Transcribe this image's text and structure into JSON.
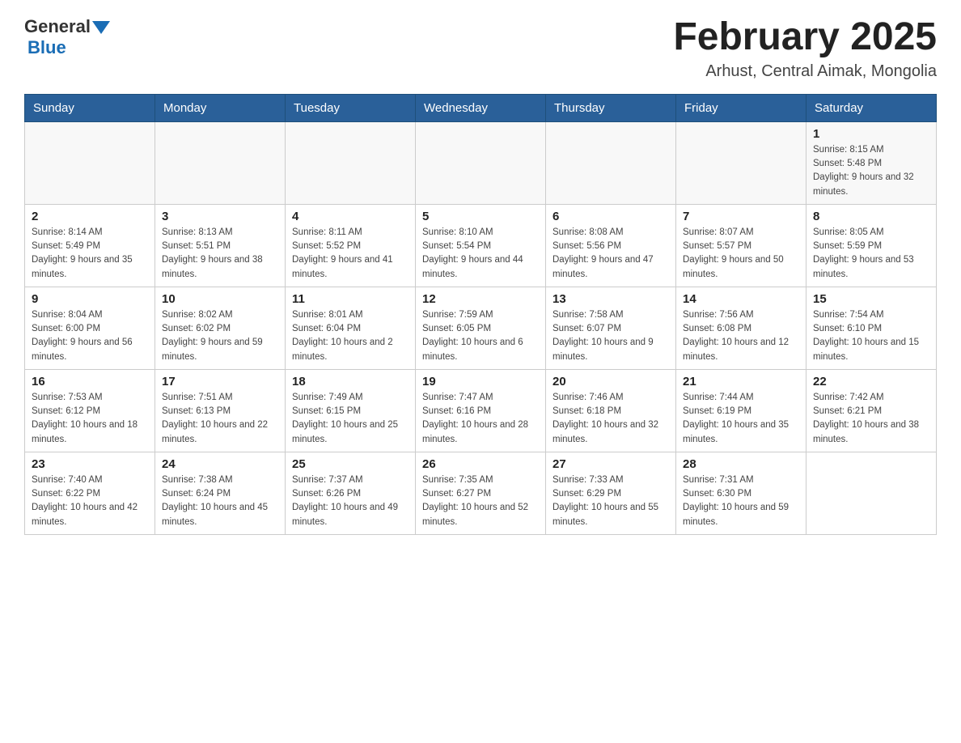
{
  "header": {
    "logo_general": "General",
    "logo_blue": "Blue",
    "title": "February 2025",
    "subtitle": "Arhust, Central Aimak, Mongolia"
  },
  "days_of_week": [
    "Sunday",
    "Monday",
    "Tuesday",
    "Wednesday",
    "Thursday",
    "Friday",
    "Saturday"
  ],
  "weeks": [
    {
      "days": [
        {
          "date": "",
          "info": ""
        },
        {
          "date": "",
          "info": ""
        },
        {
          "date": "",
          "info": ""
        },
        {
          "date": "",
          "info": ""
        },
        {
          "date": "",
          "info": ""
        },
        {
          "date": "",
          "info": ""
        },
        {
          "date": "1",
          "info": "Sunrise: 8:15 AM\nSunset: 5:48 PM\nDaylight: 9 hours and 32 minutes."
        }
      ]
    },
    {
      "days": [
        {
          "date": "2",
          "info": "Sunrise: 8:14 AM\nSunset: 5:49 PM\nDaylight: 9 hours and 35 minutes."
        },
        {
          "date": "3",
          "info": "Sunrise: 8:13 AM\nSunset: 5:51 PM\nDaylight: 9 hours and 38 minutes."
        },
        {
          "date": "4",
          "info": "Sunrise: 8:11 AM\nSunset: 5:52 PM\nDaylight: 9 hours and 41 minutes."
        },
        {
          "date": "5",
          "info": "Sunrise: 8:10 AM\nSunset: 5:54 PM\nDaylight: 9 hours and 44 minutes."
        },
        {
          "date": "6",
          "info": "Sunrise: 8:08 AM\nSunset: 5:56 PM\nDaylight: 9 hours and 47 minutes."
        },
        {
          "date": "7",
          "info": "Sunrise: 8:07 AM\nSunset: 5:57 PM\nDaylight: 9 hours and 50 minutes."
        },
        {
          "date": "8",
          "info": "Sunrise: 8:05 AM\nSunset: 5:59 PM\nDaylight: 9 hours and 53 minutes."
        }
      ]
    },
    {
      "days": [
        {
          "date": "9",
          "info": "Sunrise: 8:04 AM\nSunset: 6:00 PM\nDaylight: 9 hours and 56 minutes."
        },
        {
          "date": "10",
          "info": "Sunrise: 8:02 AM\nSunset: 6:02 PM\nDaylight: 9 hours and 59 minutes."
        },
        {
          "date": "11",
          "info": "Sunrise: 8:01 AM\nSunset: 6:04 PM\nDaylight: 10 hours and 2 minutes."
        },
        {
          "date": "12",
          "info": "Sunrise: 7:59 AM\nSunset: 6:05 PM\nDaylight: 10 hours and 6 minutes."
        },
        {
          "date": "13",
          "info": "Sunrise: 7:58 AM\nSunset: 6:07 PM\nDaylight: 10 hours and 9 minutes."
        },
        {
          "date": "14",
          "info": "Sunrise: 7:56 AM\nSunset: 6:08 PM\nDaylight: 10 hours and 12 minutes."
        },
        {
          "date": "15",
          "info": "Sunrise: 7:54 AM\nSunset: 6:10 PM\nDaylight: 10 hours and 15 minutes."
        }
      ]
    },
    {
      "days": [
        {
          "date": "16",
          "info": "Sunrise: 7:53 AM\nSunset: 6:12 PM\nDaylight: 10 hours and 18 minutes."
        },
        {
          "date": "17",
          "info": "Sunrise: 7:51 AM\nSunset: 6:13 PM\nDaylight: 10 hours and 22 minutes."
        },
        {
          "date": "18",
          "info": "Sunrise: 7:49 AM\nSunset: 6:15 PM\nDaylight: 10 hours and 25 minutes."
        },
        {
          "date": "19",
          "info": "Sunrise: 7:47 AM\nSunset: 6:16 PM\nDaylight: 10 hours and 28 minutes."
        },
        {
          "date": "20",
          "info": "Sunrise: 7:46 AM\nSunset: 6:18 PM\nDaylight: 10 hours and 32 minutes."
        },
        {
          "date": "21",
          "info": "Sunrise: 7:44 AM\nSunset: 6:19 PM\nDaylight: 10 hours and 35 minutes."
        },
        {
          "date": "22",
          "info": "Sunrise: 7:42 AM\nSunset: 6:21 PM\nDaylight: 10 hours and 38 minutes."
        }
      ]
    },
    {
      "days": [
        {
          "date": "23",
          "info": "Sunrise: 7:40 AM\nSunset: 6:22 PM\nDaylight: 10 hours and 42 minutes."
        },
        {
          "date": "24",
          "info": "Sunrise: 7:38 AM\nSunset: 6:24 PM\nDaylight: 10 hours and 45 minutes."
        },
        {
          "date": "25",
          "info": "Sunrise: 7:37 AM\nSunset: 6:26 PM\nDaylight: 10 hours and 49 minutes."
        },
        {
          "date": "26",
          "info": "Sunrise: 7:35 AM\nSunset: 6:27 PM\nDaylight: 10 hours and 52 minutes."
        },
        {
          "date": "27",
          "info": "Sunrise: 7:33 AM\nSunset: 6:29 PM\nDaylight: 10 hours and 55 minutes."
        },
        {
          "date": "28",
          "info": "Sunrise: 7:31 AM\nSunset: 6:30 PM\nDaylight: 10 hours and 59 minutes."
        },
        {
          "date": "",
          "info": ""
        }
      ]
    }
  ]
}
